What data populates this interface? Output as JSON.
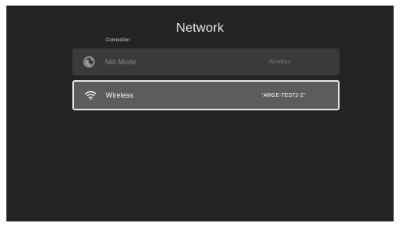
{
  "screen": {
    "title": "Network",
    "section_label": "Connection"
  },
  "rows": [
    {
      "label": "Net Mode",
      "value": "Wireless",
      "icon": "globe-icon",
      "state": "disabled"
    },
    {
      "label": "Wireless",
      "value": "\"ARGE-TEST2-2\"",
      "icon": "wifi-icon",
      "state": "focused"
    }
  ],
  "colors": {
    "background": "#232323",
    "row_disabled": "#3a3a3a",
    "row_focused": "#5c5c5c",
    "focus_border": "#e6e6e6"
  }
}
